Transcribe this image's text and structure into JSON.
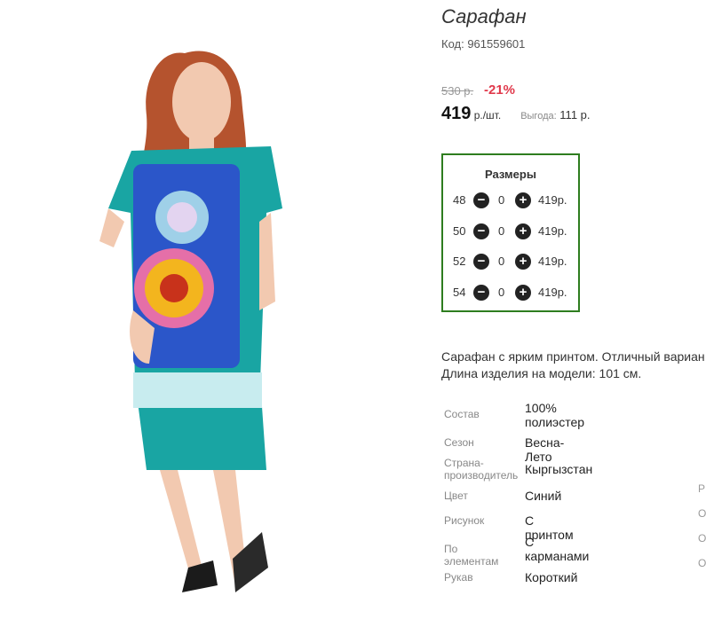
{
  "product": {
    "title": "Сарафан",
    "code": "Код: 961559601"
  },
  "pricing": {
    "old_price": "530 р.",
    "discount": "-21%",
    "price": "419",
    "price_unit": " р./шт.",
    "saving_label": "Выгода:",
    "saving_value": " 111 р."
  },
  "sizes": {
    "title": "Размеры",
    "rows": [
      {
        "size": "48",
        "qty": "0",
        "price": "419р."
      },
      {
        "size": "50",
        "qty": "0",
        "price": "419р."
      },
      {
        "size": "52",
        "qty": "0",
        "price": "419р."
      },
      {
        "size": "54",
        "qty": "0",
        "price": "419р."
      }
    ],
    "minus_symbol": "−",
    "plus_symbol": "+"
  },
  "description": {
    "line1": "Сарафан с ярким принтом. Отличный вариан",
    "line2": "Длина изделия на модели: 101 см."
  },
  "attributes": [
    {
      "label": "Состав",
      "value": "100% полиэстер"
    },
    {
      "label": "Сезон",
      "value": "Весна-Лето"
    },
    {
      "label": "Страна-производитель",
      "value": "Кыргызстан"
    },
    {
      "label": "Цвет",
      "value": "Синий"
    },
    {
      "label": "Рисунок",
      "value": "С принтом"
    },
    {
      "label": "По элементам",
      "value": "С карманами"
    },
    {
      "label": "Рукав",
      "value": "Короткий"
    }
  ],
  "edge_fragments": [
    "Р",
    "О",
    "О",
    "О"
  ],
  "colors": {
    "accent_border": "#2e7d1f",
    "discount": "#e0394b",
    "dress": "#19a5a3"
  }
}
